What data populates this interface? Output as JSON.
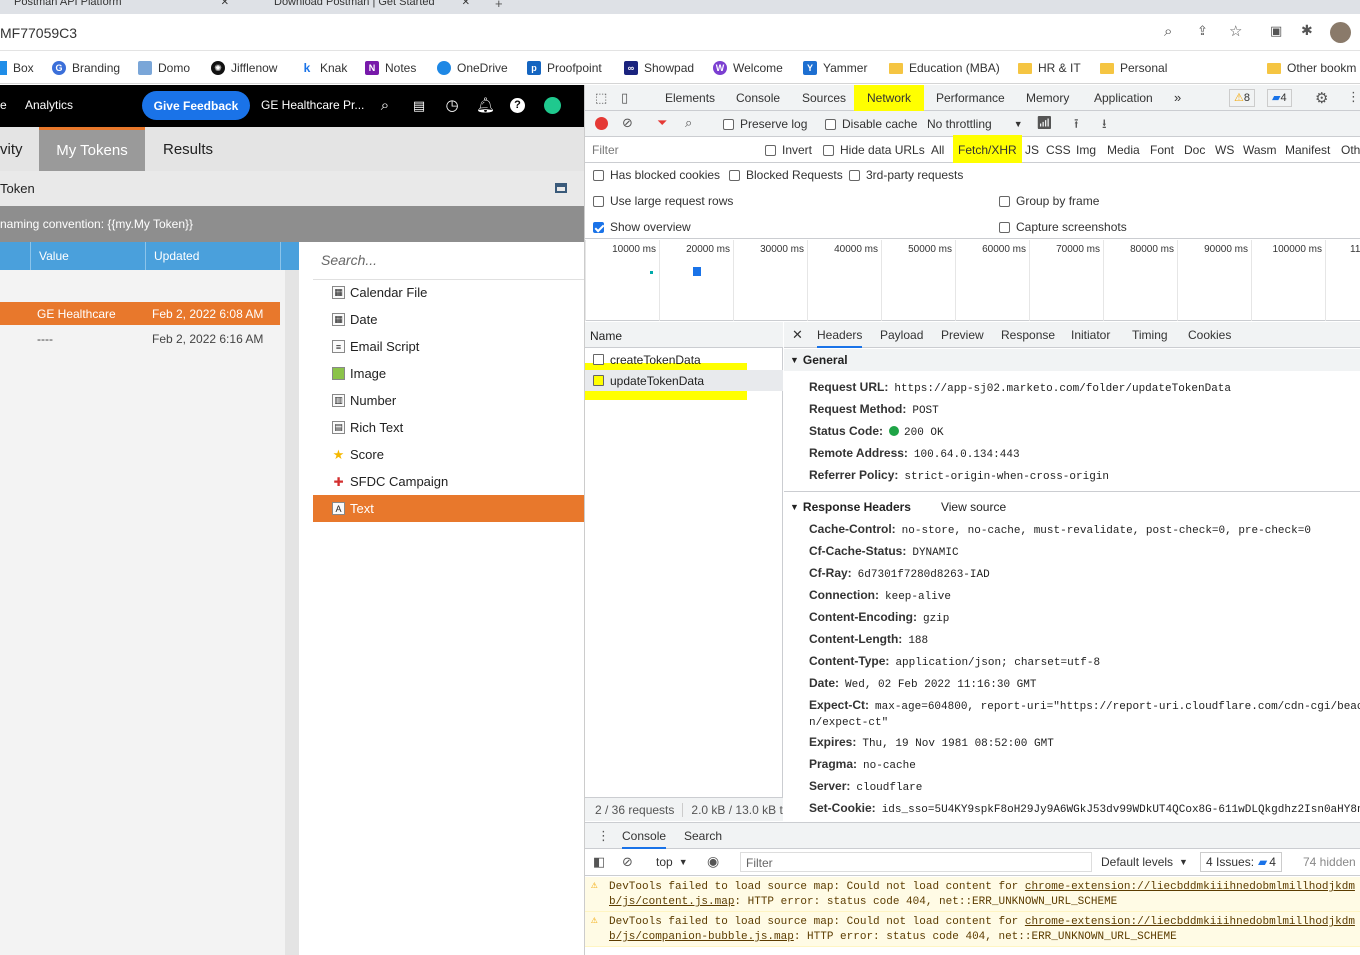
{
  "browser": {
    "tabs": [
      {
        "label": "Postman API Platform"
      },
      {
        "label": "Download Postman | Get Started"
      }
    ],
    "address": "MF77059C3",
    "bookmarks": [
      "Box",
      "Branding",
      "Domo",
      "Jifflenow",
      "Knak",
      "Notes",
      "OneDrive",
      "Proofpoint",
      "Showpad",
      "Welcome",
      "Yammer",
      "Education (MBA)",
      "HR & IT",
      "Personal",
      "Other bookm"
    ]
  },
  "marketo": {
    "header": {
      "analytics": "Analytics",
      "feedback": "Give Feedback",
      "workspace": "GE Healthcare Pr...",
      "left_stub": "e"
    },
    "tabs": [
      {
        "label": "vity"
      },
      {
        "label": "My Tokens"
      },
      {
        "label": "Results"
      }
    ],
    "token_title": "Token",
    "naming": "naming convention: {{my.My Token}}",
    "columns": [
      "Value",
      "Updated"
    ],
    "rows": [
      {
        "value": "GE Healthcare",
        "updated": "Feb 2, 2022 6:08 AM"
      },
      {
        "value": "----",
        "updated": "Feb 2, 2022 6:16 AM"
      }
    ],
    "search_placeholder": "Search...",
    "token_types": [
      "Calendar File",
      "Date",
      "Email Script",
      "Image",
      "Number",
      "Rich Text",
      "Score",
      "SFDC Campaign",
      "Text"
    ],
    "selected_type": "Text"
  },
  "devtools": {
    "tabs": [
      "Elements",
      "Console",
      "Sources",
      "Network",
      "Performance",
      "Memory",
      "Application"
    ],
    "active_tab": "Network",
    "warnings_count": "8",
    "messages_count": "4",
    "toolbar": {
      "preserve_log": "Preserve log",
      "disable_cache": "Disable cache",
      "throttling": "No throttling"
    },
    "filter": {
      "placeholder": "Filter",
      "invert": "Invert",
      "hide_data": "Hide data URLs",
      "types": [
        "All",
        "Fetch/XHR",
        "JS",
        "CSS",
        "Img",
        "Media",
        "Font",
        "Doc",
        "WS",
        "Wasm",
        "Manifest",
        "Oth"
      ],
      "active_type": "Fetch/XHR"
    },
    "options": {
      "blocked_cookies": "Has blocked cookies",
      "blocked_requests": "Blocked Requests",
      "third_party": "3rd-party requests",
      "large_rows": "Use large request rows",
      "group_by_frame": "Group by frame",
      "show_overview": "Show overview",
      "capture_screenshots": "Capture screenshots"
    },
    "timeline_ticks": [
      "10000 ms",
      "20000 ms",
      "30000 ms",
      "40000 ms",
      "50000 ms",
      "60000 ms",
      "70000 ms",
      "80000 ms",
      "90000 ms",
      "100000 ms",
      "11"
    ],
    "name_header": "Name",
    "requests": [
      "createTokenData",
      "updateTokenData"
    ],
    "selected_request": "updateTokenData",
    "footer": {
      "requests": "2 / 36 requests",
      "transferred": "2.0 kB / 13.0 kB t"
    },
    "detail_tabs": [
      "Headers",
      "Payload",
      "Preview",
      "Response",
      "Initiator",
      "Timing",
      "Cookies"
    ],
    "general_title": "General",
    "general": [
      {
        "k": "Request URL:",
        "v": "https://app-sj02.marketo.com/folder/updateTokenData"
      },
      {
        "k": "Request Method:",
        "v": "POST"
      },
      {
        "k": "Status Code:",
        "v": "200 OK"
      },
      {
        "k": "Remote Address:",
        "v": "100.64.0.134:443"
      },
      {
        "k": "Referrer Policy:",
        "v": "strict-origin-when-cross-origin"
      }
    ],
    "response_title": "Response Headers",
    "view_source": "View source",
    "response": [
      {
        "k": "Cache-Control:",
        "v": "no-store, no-cache, must-revalidate, post-check=0, pre-check=0"
      },
      {
        "k": "Cf-Cache-Status:",
        "v": "DYNAMIC"
      },
      {
        "k": "Cf-Ray:",
        "v": "6d7301f7280d8263-IAD"
      },
      {
        "k": "Connection:",
        "v": "keep-alive"
      },
      {
        "k": "Content-Encoding:",
        "v": "gzip"
      },
      {
        "k": "Content-Length:",
        "v": "188"
      },
      {
        "k": "Content-Type:",
        "v": "application/json; charset=utf-8"
      },
      {
        "k": "Date:",
        "v": "Wed, 02 Feb 2022 11:16:30 GMT"
      },
      {
        "k": "Expect-Ct:",
        "v": "max-age=604800, report-uri=\"https://report-uri.cloudflare.com/cdn-cgi/beac"
      },
      {
        "k": "",
        "v": "n/expect-ct\""
      },
      {
        "k": "Expires:",
        "v": "Thu, 19 Nov 1981 08:52:00 GMT"
      },
      {
        "k": "Pragma:",
        "v": "no-cache"
      },
      {
        "k": "Server:",
        "v": "cloudflare"
      },
      {
        "k": "Set-Cookie:",
        "v": "ids_sso=5U4KY9spkF8oH29Jy9A6WGkJ53dv99WDkUT4QCox8G-611wDLQkgdhz2Isn0aHY8n"
      }
    ],
    "drawer": {
      "tabs": [
        "Console",
        "Search"
      ],
      "context": "top",
      "filter": "Filter",
      "levels": "Default levels",
      "issues": "4 Issues:",
      "issues_count": "4",
      "hidden": "74 hidden",
      "messages": [
        {
          "text": "DevTools failed to load source map: Could not load content for ",
          "link": "chrome-extension://liecbddmkiiihnedobmlmillhodjkdm",
          "link2": "b/js/content.js.map",
          "tail": ": HTTP error: status code 404, net::ERR_UNKNOWN_URL_SCHEME"
        },
        {
          "text": "DevTools failed to load source map: Could not load content for ",
          "link": "chrome-extension://liecbddmkiiihnedobmlmillhodjkdm",
          "link2": "b/js/companion-bubble.js.map",
          "tail": ": HTTP error: status code 404, net::ERR_UNKNOWN_URL_SCHEME"
        }
      ]
    }
  },
  "colors": {
    "accent_orange": "#e8782c",
    "highlight": "#ffff00",
    "blue_header": "#4aa0dc",
    "feedback_blue": "#1a73e8"
  }
}
